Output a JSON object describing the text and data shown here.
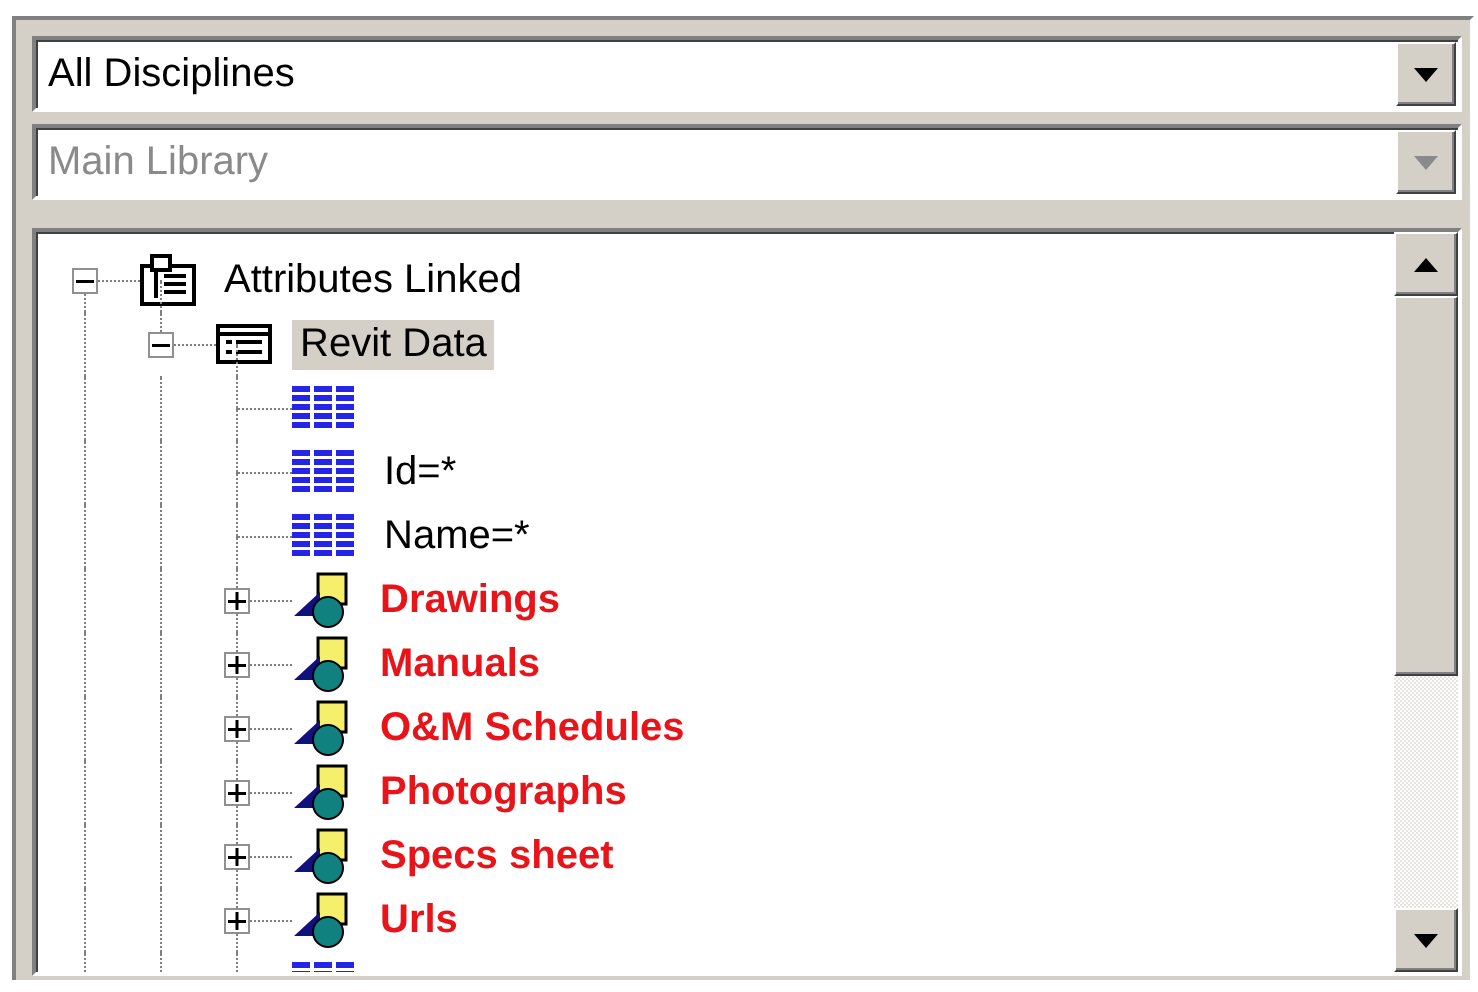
{
  "filters": [
    {
      "value": "All Disciplines",
      "disabled": false
    },
    {
      "value": "Main Library",
      "disabled": true
    }
  ],
  "tree": [
    {
      "kind": "folder",
      "label": "Attributes Linked",
      "expanded": true,
      "selected": false,
      "children": [
        {
          "kind": "table",
          "label": "Revit Data",
          "expanded": true,
          "selected": true,
          "children": [
            {
              "kind": "field",
              "selected": false
            },
            {
              "kind": "field",
              "label": "Id=*",
              "selected": false
            },
            {
              "kind": "field",
              "label": "Name=*",
              "selected": false
            },
            {
              "kind": "group",
              "label": "Drawings",
              "expanded": false,
              "selected": false
            },
            {
              "kind": "group",
              "label": "Manuals",
              "expanded": false,
              "selected": false
            },
            {
              "kind": "group",
              "label": "O&M Schedules",
              "expanded": false,
              "selected": false
            },
            {
              "kind": "group",
              "label": "Photographs",
              "expanded": false,
              "selected": false
            },
            {
              "kind": "group",
              "label": "Specs sheet",
              "expanded": false,
              "selected": false
            },
            {
              "kind": "group",
              "label": "Urls",
              "expanded": false,
              "selected": false
            },
            {
              "kind": "field",
              "selected": false
            }
          ]
        }
      ]
    }
  ]
}
